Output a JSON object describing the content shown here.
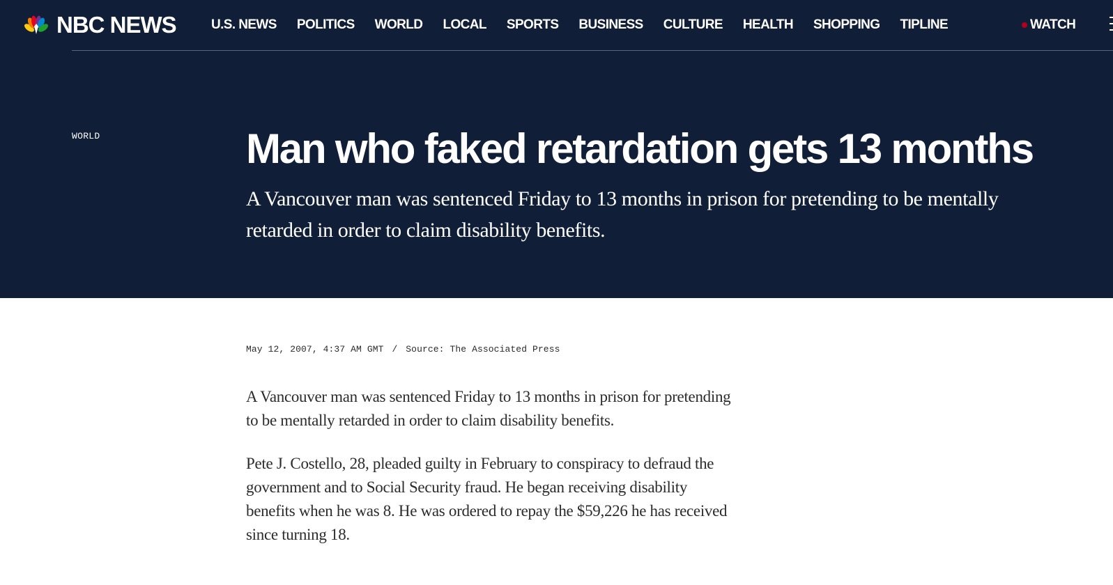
{
  "header": {
    "logo_text": "NBC NEWS",
    "nav": [
      "U.S. NEWS",
      "POLITICS",
      "WORLD",
      "LOCAL",
      "SPORTS",
      "BUSINESS",
      "CULTURE",
      "HEALTH",
      "SHOPPING",
      "TIPLINE"
    ],
    "watch_label": "WATCH",
    "menu_icon": "hamburger-menu-icon"
  },
  "article": {
    "section": "WORLD",
    "headline": "Man who faked retardation gets 13 months",
    "dek": "A Vancouver man was sentenced Friday to 13 months in prison for pretending to be mentally retarded in order to claim disability benefits.",
    "date": "May 12, 2007, 4:37 AM GMT",
    "byline_separator": "/",
    "source": "Source: The Associated Press",
    "paragraphs": [
      "A Vancouver man was sentenced Friday to 13 months in prison for pretending to be mentally retarded in order to claim disability benefits.",
      "Pete J. Costello, 28, pleaded guilty in February to conspiracy to defraud the government and to Social Security fraud. He began receiving disability benefits when he was 8. He was ordered to repay the $59,226 he has received since turning 18."
    ]
  },
  "colors": {
    "hero_background": "#101e38",
    "live_dot": "#b00020",
    "body_text": "#2b2b2b"
  }
}
